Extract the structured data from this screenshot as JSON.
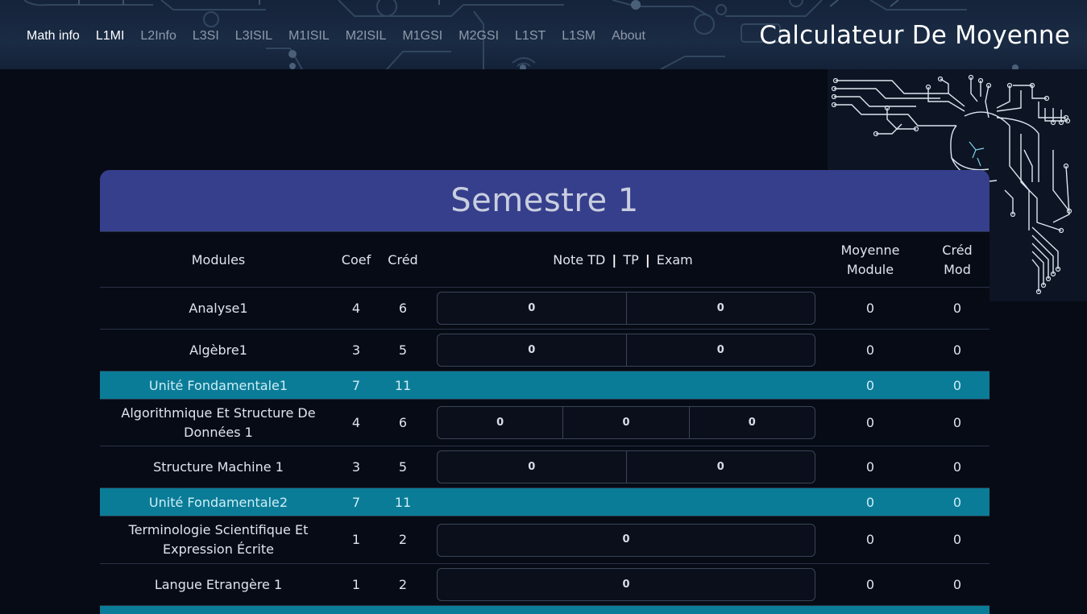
{
  "nav": {
    "items": [
      "Math info",
      "L1MI",
      "L2Info",
      "L3SI",
      "L3ISIL",
      "M1ISIL",
      "M2ISIL",
      "M1GSI",
      "M2GSI",
      "L1ST",
      "L1SM",
      "About"
    ],
    "brand": "Calculateur De Moyenne"
  },
  "semester": {
    "title": "Semestre 1",
    "headers": {
      "modules": "Modules",
      "coef": "Coef",
      "cred": "Créd",
      "note_td": "Note TD",
      "sep": "|",
      "tp": "TP",
      "exam": "Exam",
      "moyenne_1": "Moyenne",
      "moyenne_2": "Module",
      "cred_mod_1": "Créd",
      "cred_mod_2": "Mod"
    },
    "rows": [
      {
        "name": "Analyse1",
        "coef": "4",
        "cred": "6",
        "inputs": [
          "0",
          "0"
        ],
        "moyenne": "0",
        "cred_mod": "0"
      },
      {
        "name": "Algèbre1",
        "coef": "3",
        "cred": "5",
        "inputs": [
          "0",
          "0"
        ],
        "moyenne": "0",
        "cred_mod": "0"
      },
      {
        "name": "Unité Fondamentale1",
        "coef": "7",
        "cred": "11",
        "moyenne": "0",
        "cred_mod": "0"
      },
      {
        "name": "Algorithmique Et Structure De Données 1",
        "coef": "4",
        "cred": "6",
        "inputs": [
          "0",
          "0",
          "0"
        ],
        "moyenne": "0",
        "cred_mod": "0"
      },
      {
        "name": "Structure Machine 1",
        "coef": "3",
        "cred": "5",
        "inputs": [
          "0",
          "0"
        ],
        "moyenne": "0",
        "cred_mod": "0"
      },
      {
        "name": "Unité Fondamentale2",
        "coef": "7",
        "cred": "11",
        "moyenne": "0",
        "cred_mod": "0"
      },
      {
        "name": "Terminologie Scientifique Et Expression Écrite",
        "coef": "1",
        "cred": "2",
        "inputs": [
          "0"
        ],
        "moyenne": "0",
        "cred_mod": "0"
      },
      {
        "name": "Langue Etrangère 1",
        "coef": "1",
        "cred": "2",
        "inputs": [
          "0"
        ],
        "moyenne": "0",
        "cred_mod": "0"
      }
    ]
  },
  "colors": {
    "header_bg": "#1a2b44",
    "title_bar": "#363f8b",
    "summary_row": "#0b7c97",
    "circuit": "#cfe3ee"
  }
}
